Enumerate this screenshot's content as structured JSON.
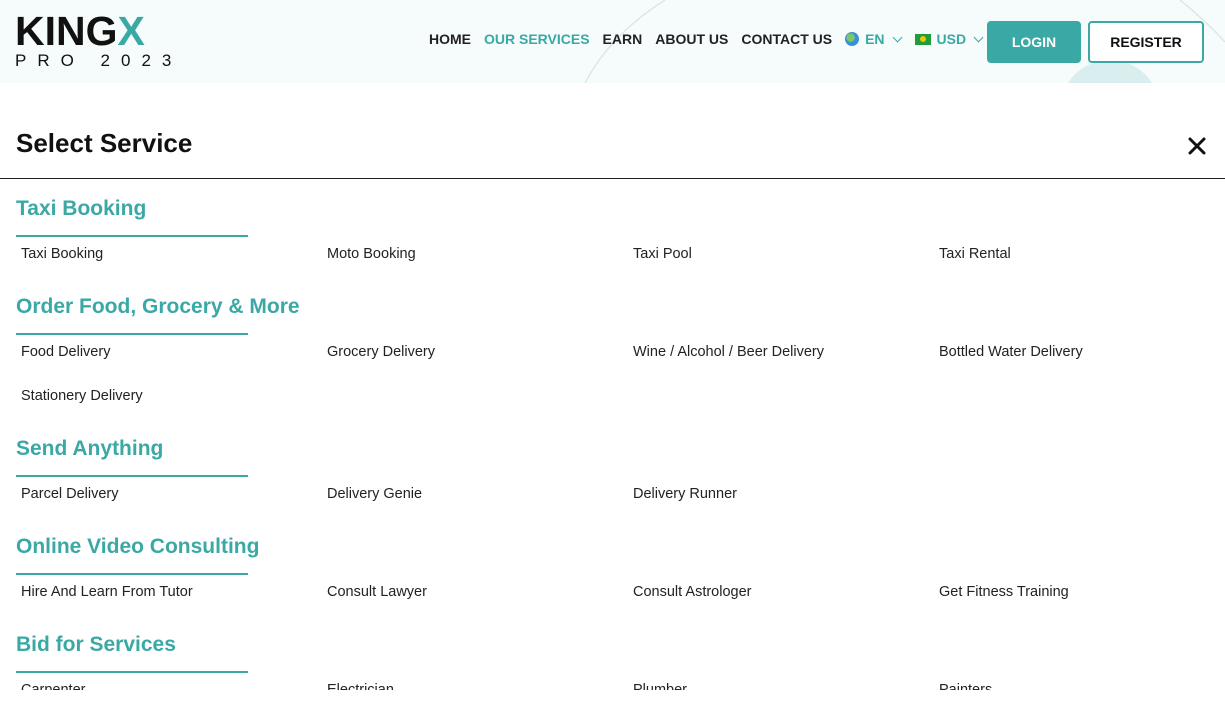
{
  "header": {
    "logo": {
      "main_prefix": "KING",
      "main_accent": "X",
      "sub": "PRO 2023"
    },
    "nav": {
      "home": "HOME",
      "services": "OUR SERVICES",
      "earn": "EARN",
      "about": "ABOUT US",
      "contact": "CONTACT US"
    },
    "language": {
      "label": "EN",
      "icon": "globe-icon"
    },
    "currency": {
      "label": "USD",
      "icon": "flag-icon"
    },
    "login_label": "LOGIN",
    "register_label": "REGISTER"
  },
  "modal": {
    "title": "Select Service",
    "close_icon": "close-icon",
    "sections": [
      {
        "title": "Taxi Booking",
        "items": [
          "Taxi Booking",
          "Moto Booking",
          "Taxi Pool",
          "Taxi Rental"
        ]
      },
      {
        "title": "Order Food, Grocery & More",
        "items": [
          "Food Delivery",
          "Grocery Delivery",
          "Wine / Alcohol / Beer Delivery",
          "Bottled Water Delivery",
          "Stationery Delivery"
        ]
      },
      {
        "title": "Send Anything",
        "items": [
          "Parcel Delivery",
          "Delivery Genie",
          "Delivery Runner"
        ]
      },
      {
        "title": "Online Video Consulting",
        "items": [
          "Hire And Learn From Tutor",
          "Consult Lawyer",
          "Consult Astrologer",
          "Get Fitness Training"
        ]
      },
      {
        "title": "Bid for Services",
        "items": [
          "Carpenter",
          "Electrician",
          "Plumber",
          "Painters"
        ]
      }
    ]
  },
  "colors": {
    "accent": "#3aa9a5",
    "text": "#222222",
    "header_bg": "#f6fbfb"
  }
}
